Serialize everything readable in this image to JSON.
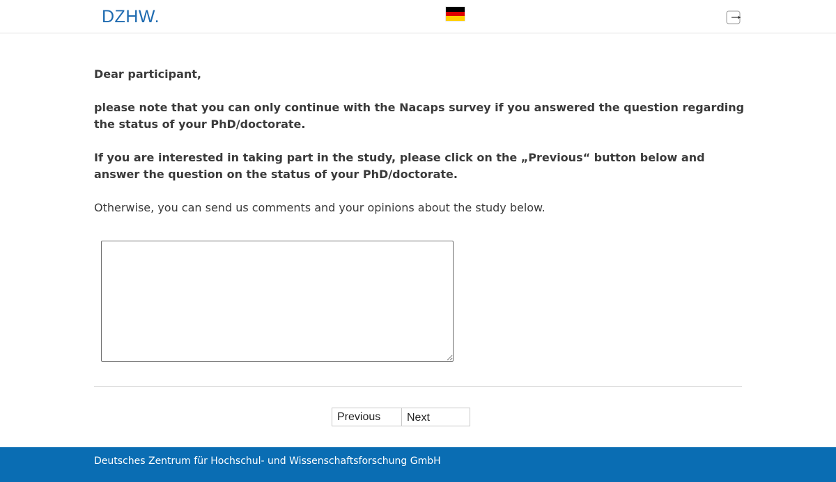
{
  "header": {
    "logo_text": "DZHW.",
    "language_flag": "germany-flag-icon",
    "logout_icon": "logout-icon"
  },
  "main": {
    "greeting": "Dear participant,",
    "paragraph_1": "please note that you can only continue with the Nacaps survey if you answered the question regarding the status of your PhD/doctorate.",
    "paragraph_2": "If you are interested in taking part in the study, please click on the „Previous“ button below and answer the question on the status of your PhD/doctorate.",
    "paragraph_3": "Otherwise, you can send us comments and your opinions about the study below.",
    "comment_value": ""
  },
  "navigation": {
    "previous_label": "Previous",
    "next_label": "Next"
  },
  "footer": {
    "text": "Deutsches Zentrum für Hochschul- und Wissenschaftsforschung GmbH"
  },
  "colors": {
    "brand_blue": "#1f6bb0",
    "footer_blue": "#0a6db3",
    "text": "#3a3a3a"
  }
}
